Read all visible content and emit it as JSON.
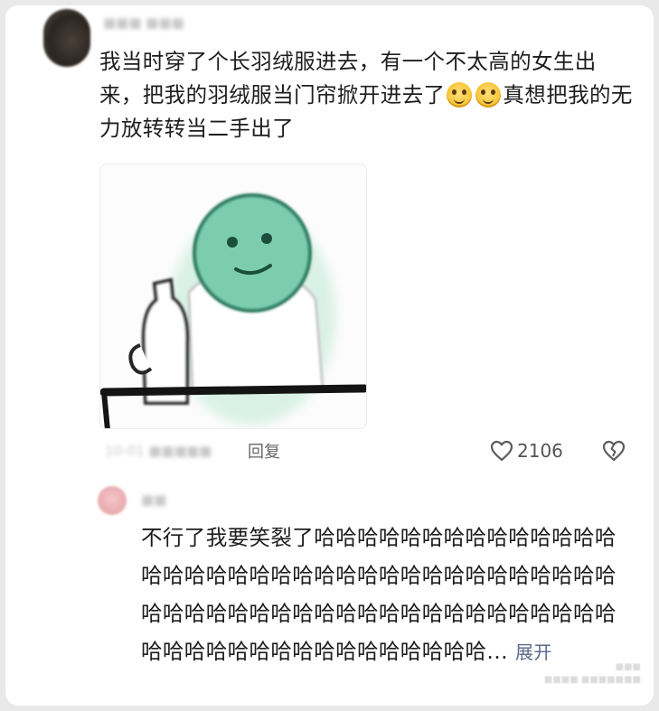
{
  "comment": {
    "text_before_emoji": "我当时穿了个长羽绒服进去，有一个不太高的女生出来，把我的羽绒服当门帘掀开进去了",
    "emojis": [
      "grinning-face-emoji",
      "grinning-face-emoji"
    ],
    "text_after_emoji": "真想把我的无力放转转当二手出了",
    "image": "meme-sticker-green-face-character"
  },
  "actions": {
    "reply_label": "回复",
    "like_count": "2106"
  },
  "reply": {
    "text": "不行了我要笑裂了哈哈哈哈哈哈哈哈哈哈哈哈哈哈哈哈哈哈哈哈哈哈哈哈哈哈哈哈哈哈哈哈哈哈哈哈哈哈哈哈哈哈哈哈哈哈哈哈哈哈哈哈哈哈哈哈哈哈哈哈哈哈哈哈哈哈哈哈哈哈哈哈哈哈...",
    "expand_label": "展开"
  }
}
